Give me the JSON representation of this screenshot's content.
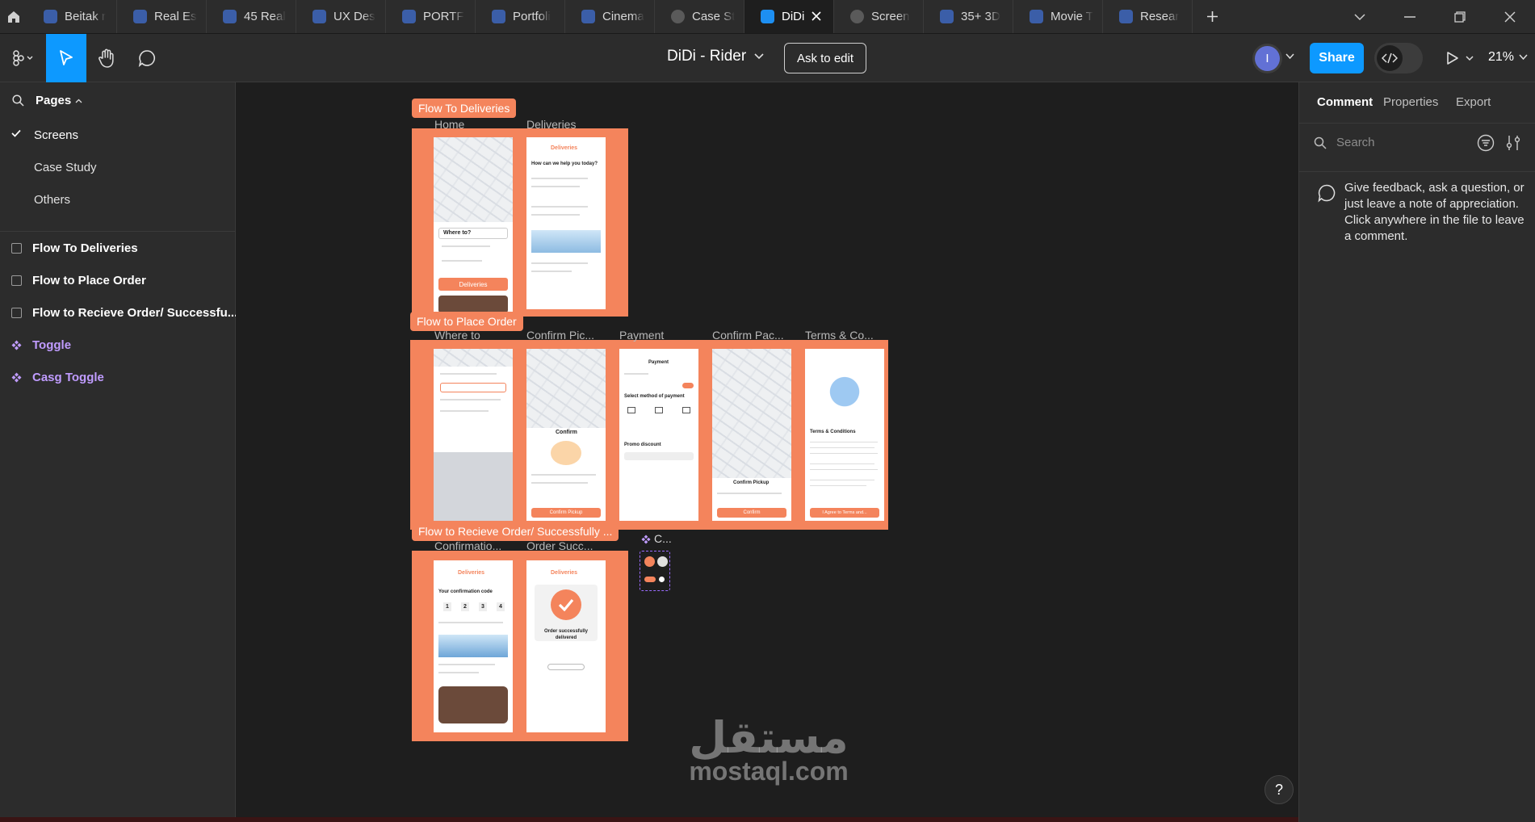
{
  "tabs": [
    {
      "label": "Beitak r",
      "icon": "figma-file-icon"
    },
    {
      "label": "Real Es",
      "icon": "figma-file-icon"
    },
    {
      "label": "45 Real",
      "icon": "figma-file-icon"
    },
    {
      "label": "UX Des",
      "icon": "figma-file-icon"
    },
    {
      "label": "PORTF",
      "icon": "figma-file-icon"
    },
    {
      "label": "Portfoli",
      "icon": "figma-file-icon"
    },
    {
      "label": "Cinema",
      "icon": "figma-file-icon"
    },
    {
      "label": "Case St",
      "icon": "prototype-play-icon"
    },
    {
      "label": "DiDi",
      "icon": "figma-file-icon",
      "active": true
    },
    {
      "label": "Screen",
      "icon": "prototype-play-icon"
    },
    {
      "label": "35+ 3D",
      "icon": "figma-file-icon"
    },
    {
      "label": "Movie T",
      "icon": "figma-file-icon"
    },
    {
      "label": "Resear",
      "icon": "figma-file-icon"
    }
  ],
  "toolbar": {
    "file_title": "DiDi - Rider",
    "ask_to_edit": "Ask to edit",
    "avatar_initial": "I",
    "share": "Share",
    "zoom": "21%"
  },
  "pages": {
    "header": "Pages",
    "items": [
      "Screens",
      "Case Study",
      "Others"
    ],
    "selected": "Screens"
  },
  "layers": [
    {
      "label": "Flow To Deliveries",
      "kind": "section"
    },
    {
      "label": "Flow to Place Order",
      "kind": "section"
    },
    {
      "label": "Flow to Recieve Order/ Successfu...",
      "kind": "section"
    },
    {
      "label": "Toggle",
      "kind": "component"
    },
    {
      "label": "Casg Toggle",
      "kind": "component"
    }
  ],
  "canvas": {
    "sections": {
      "deliveries": {
        "label": "Flow To Deliveries",
        "frames": [
          "Home",
          "Deliveries"
        ]
      },
      "place_order": {
        "label": "Flow to Place Order",
        "frames": [
          "Where to",
          "Confirm Pic...",
          "Payment",
          "Confirm Pac...",
          "Terms & Co..."
        ]
      },
      "receive": {
        "label": "Flow to Recieve Order/ Successfully ...",
        "frames": [
          "Confirmatio...",
          "Order Succ..."
        ]
      }
    },
    "component_label": "C...",
    "screens": {
      "home_where_to": "Where to?",
      "home_btn": "Deliveries",
      "deliv_brand": "Deliveries",
      "deliv_q": "How can we help you today?",
      "pay_title": "Payment",
      "pay_method": "Select method of payment",
      "pay_promo": "Promo discount",
      "cp_title": "Confirm",
      "cp_btn": "Confirm Pickup",
      "cpk_title": "Confirm Pickup",
      "cpk_btn": "Confirm",
      "terms_title": "Terms & Conditions",
      "terms_btn": "I Agree to Terms and...",
      "conf_brand": "Deliveries",
      "conf_code": "Your confirmation code",
      "conf_digits": [
        "1",
        "2",
        "3",
        "4"
      ],
      "succ_brand": "Deliveries",
      "succ_msg": "Order successfully delivered"
    },
    "watermark_ar": "مستقل",
    "watermark_en": "mostaql.com"
  },
  "right_panel": {
    "tabs": [
      "Comment",
      "Properties",
      "Export"
    ],
    "active_tab": "Comment",
    "search_placeholder": "Search",
    "hint": "Give feedback, ask a question, or just leave a note of appreciation. Click anywhere in the file to leave a comment."
  },
  "help": "?",
  "colors": {
    "accent": "#0d99ff",
    "section": "#f4845c",
    "component": "#c09cff"
  }
}
